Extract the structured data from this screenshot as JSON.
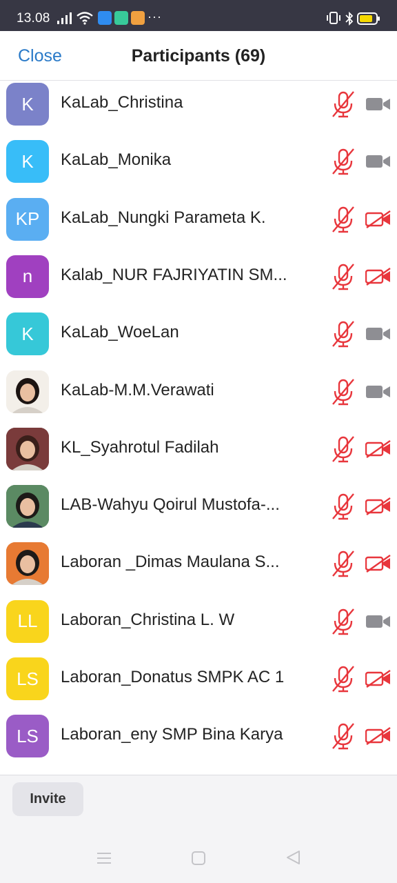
{
  "status_bar": {
    "time": "13.08",
    "more": "···",
    "icons": [
      "signal-icon",
      "wifi-icon",
      "app-icon-blue",
      "app-icon-green",
      "app-icon-orange",
      "vibrate-icon",
      "bluetooth-icon",
      "battery-icon"
    ]
  },
  "header": {
    "close_label": "Close",
    "title": "Participants (69)"
  },
  "participants": [
    {
      "initials": "K",
      "name": "KaLab_Christina",
      "avatar_color": "#7b82c9",
      "video_muted": false
    },
    {
      "initials": "K",
      "name": "KaLab_Monika",
      "avatar_color": "#38bdf8",
      "video_muted": false
    },
    {
      "initials": "KP",
      "name": "KaLab_Nungki Parameta K.",
      "avatar_color": "#5aaef2",
      "video_muted": true
    },
    {
      "initials": "n",
      "name": "Kalab_NUR FAJRIYATIN SM...",
      "avatar_color": "#a040c0",
      "video_muted": true
    },
    {
      "initials": "K",
      "name": "KaLab_WoeLan",
      "avatar_color": "#36c8d8",
      "video_muted": false
    },
    {
      "initials": "",
      "name": "KaLab-M.M.Verawati",
      "avatar_color": "#f0ece6",
      "video_muted": false
    },
    {
      "initials": "",
      "name": "KL_Syahrotul Fadilah",
      "avatar_color": "#6a3a3a",
      "video_muted": true
    },
    {
      "initials": "",
      "name": "LAB-Wahyu Qoirul Mustofa-...",
      "avatar_color": "#3e6a4a",
      "video_muted": true
    },
    {
      "initials": "",
      "name": "Laboran _Dimas Maulana S...",
      "avatar_color": "#e06a30",
      "video_muted": true
    },
    {
      "initials": "LL",
      "name": "Laboran_Christina L. W",
      "avatar_color": "#f9d51c",
      "video_muted": false
    },
    {
      "initials": "LS",
      "name": "Laboran_Donatus SMPK AC 1",
      "avatar_color": "#f9d51c",
      "video_muted": true
    },
    {
      "initials": "LS",
      "name": "Laboran_eny SMP Bina Karya",
      "avatar_color": "#9a5cc6",
      "video_muted": true
    }
  ],
  "bottom_bar": {
    "invite_label": "Invite"
  },
  "colors": {
    "accent_blue": "#2a7ac8",
    "muted_red": "#e8363c",
    "camera_gray": "#8e8e93",
    "status_bar_bg": "#373744"
  }
}
